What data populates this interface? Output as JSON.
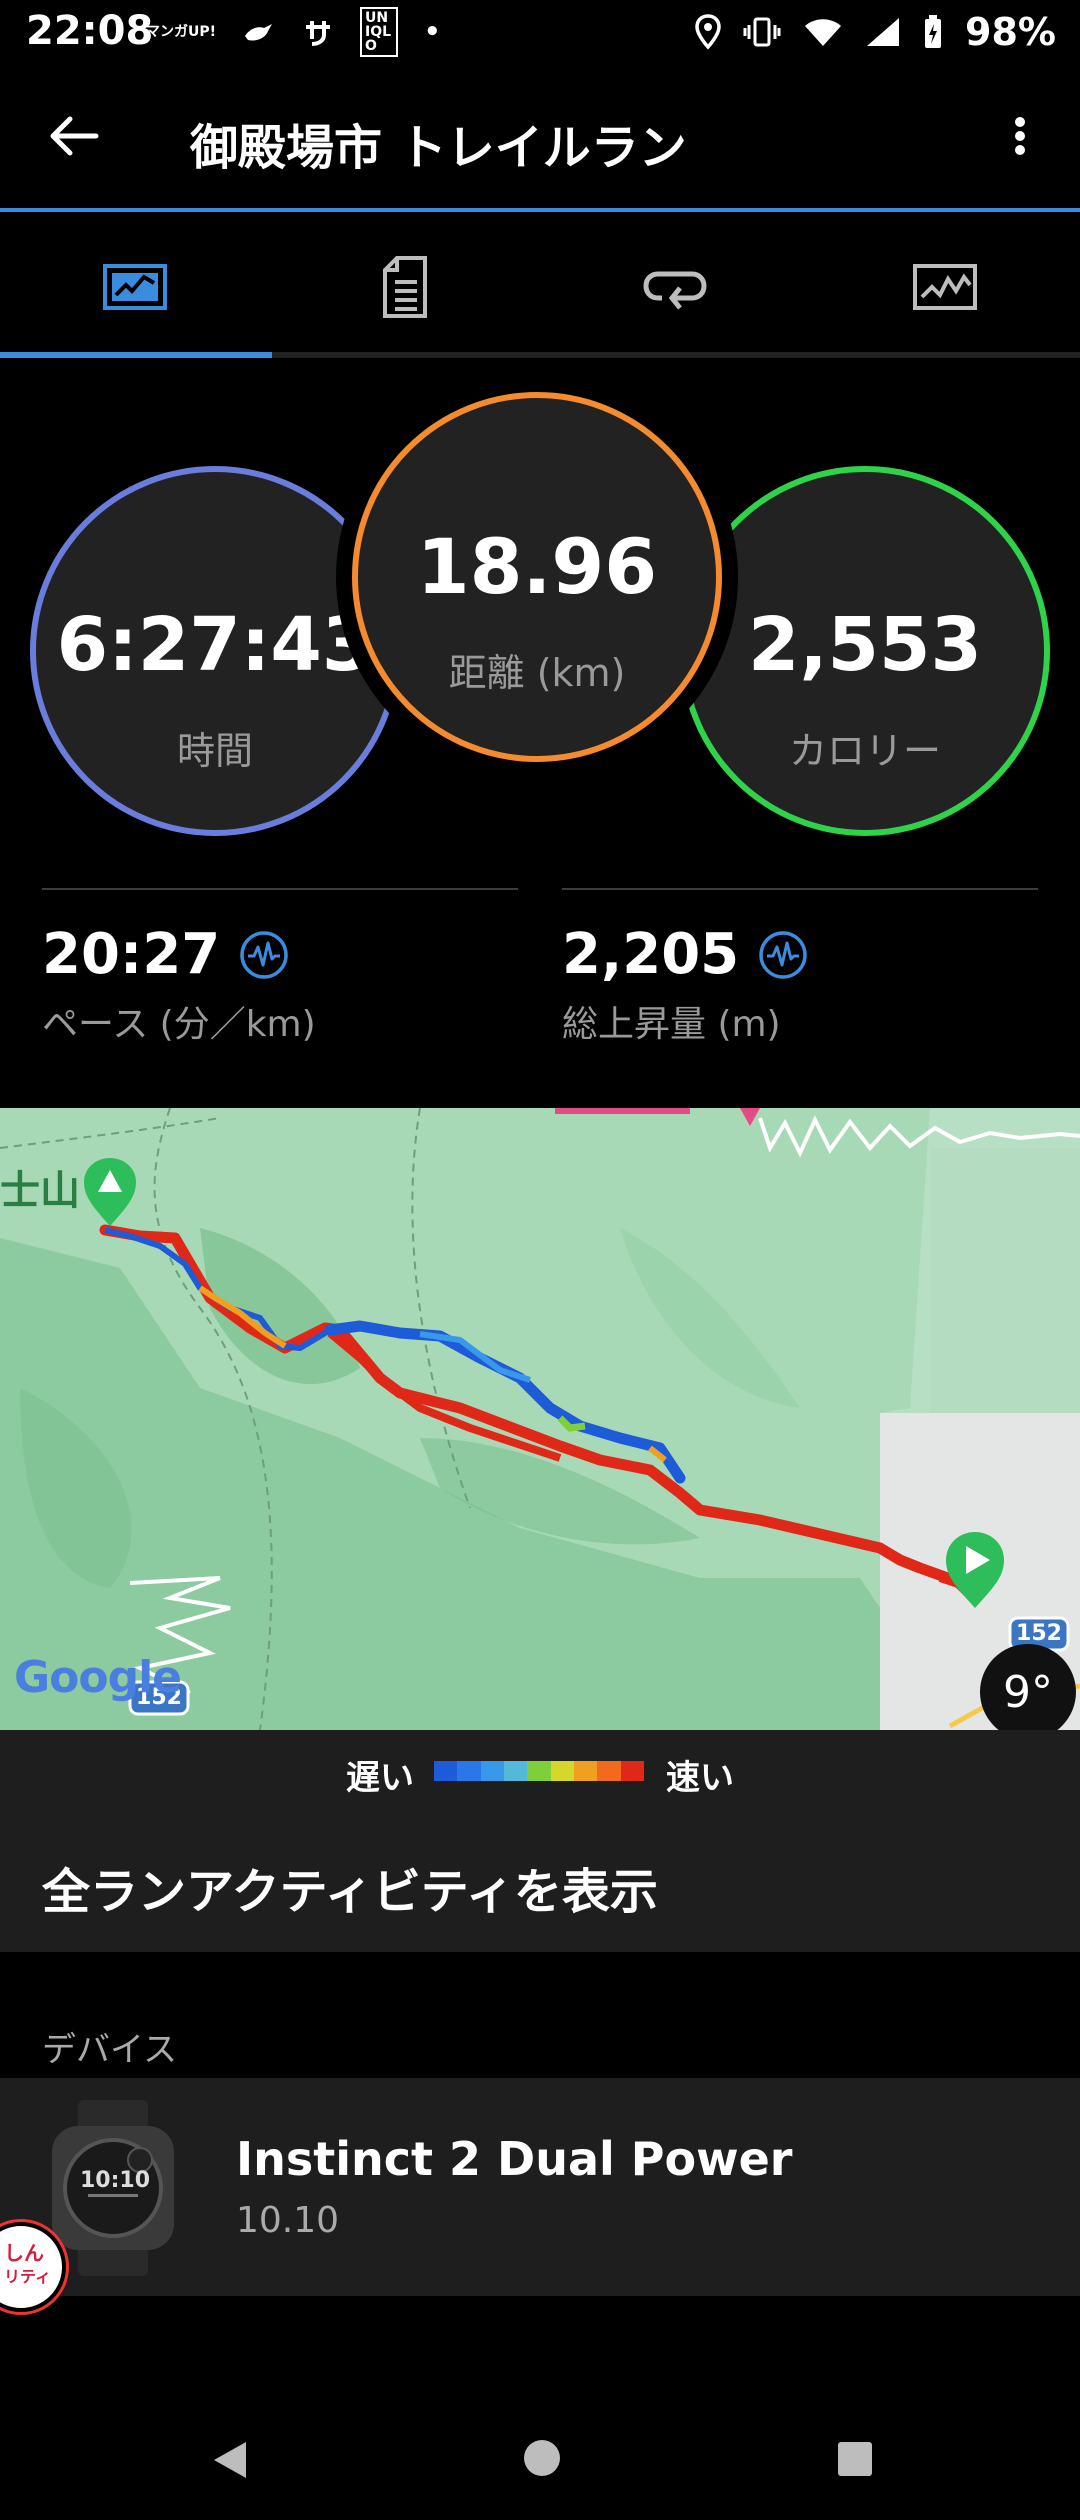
{
  "status_bar": {
    "time": "22:08",
    "notif_icons": [
      "マンガUP!",
      "bird-icon",
      "sa-icon",
      "UNIQLO",
      "•"
    ],
    "battery_text": "98%"
  },
  "app_bar": {
    "title": "御殿場市 トレイルラン"
  },
  "tabs": [
    {
      "name": "overview",
      "icon": "map-chart-icon",
      "active": true
    },
    {
      "name": "details",
      "icon": "document-list-icon",
      "active": false
    },
    {
      "name": "laps",
      "icon": "loop-icon",
      "active": false
    },
    {
      "name": "charts",
      "icon": "line-chart-icon",
      "active": false
    }
  ],
  "stats": {
    "time": {
      "value": "6:27:43",
      "label": "時間",
      "color": "#6a7ddc"
    },
    "distance": {
      "value": "18.96",
      "label": "距離 (km)",
      "color": "#f48b2e"
    },
    "calories": {
      "value": "2,553",
      "label": "カロリー",
      "color": "#2fd34a"
    }
  },
  "secondary_stats": {
    "pace": {
      "value": "20:27",
      "label": "ペース (分／km)"
    },
    "ascent": {
      "value": "2,205",
      "label": "総上昇量 (m)"
    }
  },
  "map": {
    "peak_label": "士山",
    "road_number": "152",
    "road_number_2": "152",
    "google_text": "Google",
    "temperature": "9°"
  },
  "legend": {
    "slow_label": "遅い",
    "fast_label": "速い",
    "colors": [
      "#1e5bd8",
      "#2a78e8",
      "#3a98ea",
      "#56b8d8",
      "#7fcf3a",
      "#d4d82a",
      "#f0a020",
      "#f26a1c",
      "#e02818"
    ]
  },
  "all_activities": {
    "label": "全ランアクティビティを表示"
  },
  "devices": {
    "header": "デバイス",
    "items": [
      {
        "name": "Instinct 2 Dual Power",
        "version": "10.10",
        "watch_time": "10:10"
      }
    ]
  },
  "badge": {
    "line1": "しん",
    "line2": "リティ"
  }
}
